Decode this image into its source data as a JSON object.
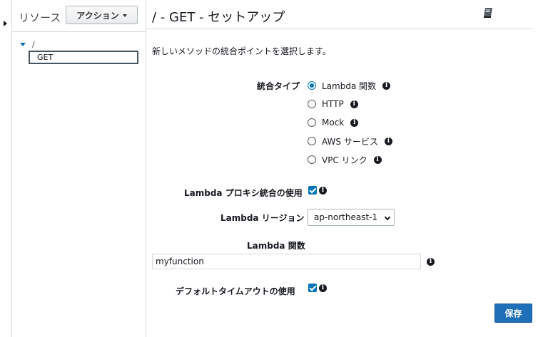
{
  "resources_panel": {
    "title": "リソース",
    "action_button": "アクション",
    "tree": {
      "root_path": "/",
      "selected_method": "GET"
    }
  },
  "header": {
    "title": "/ - GET - セットアップ",
    "help_icon": "book-icon"
  },
  "form": {
    "intro": "新しいメソッドの統合ポイントを選択します。",
    "integration_type": {
      "label": "統合タイプ",
      "options": [
        {
          "label": "Lambda 関数",
          "selected": true
        },
        {
          "label": "HTTP",
          "selected": false
        },
        {
          "label": "Mock",
          "selected": false
        },
        {
          "label": "AWS サービス",
          "selected": false
        },
        {
          "label": "VPC リンク",
          "selected": false
        }
      ]
    },
    "lambda_proxy": {
      "label": "Lambda プロキシ統合の使用",
      "checked": true
    },
    "lambda_region": {
      "label": "Lambda リージョン",
      "value": "ap-northeast-1"
    },
    "lambda_function": {
      "label": "Lambda 関数",
      "value": "myfunction"
    },
    "default_timeout": {
      "label": "デフォルトタイムアウトの使用",
      "checked": true
    },
    "save_button": "保存"
  },
  "colors": {
    "accent": "#0073bb",
    "save_button": "#1f6fb8",
    "border": "#d5dbdb"
  }
}
